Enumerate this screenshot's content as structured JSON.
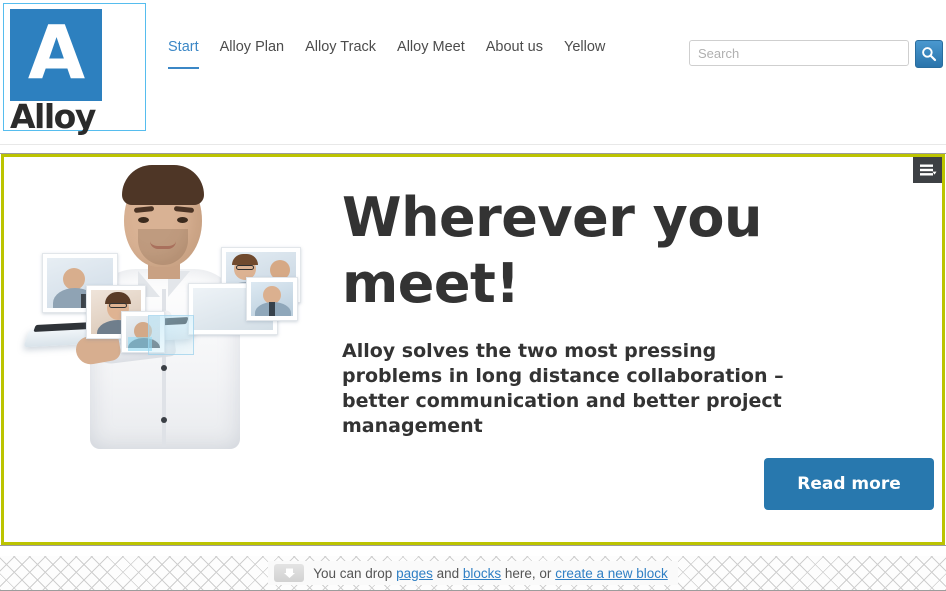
{
  "header": {
    "logo": {
      "letter": "A",
      "wordmark": "Alloy",
      "alt": "Alloy logo"
    },
    "nav": {
      "items": [
        {
          "label": "Start",
          "active": true
        },
        {
          "label": "Alloy Plan",
          "active": false
        },
        {
          "label": "Alloy Track",
          "active": false
        },
        {
          "label": "Alloy Meet",
          "active": false
        },
        {
          "label": "About us",
          "active": false
        },
        {
          "label": "Yellow",
          "active": false
        }
      ]
    },
    "search": {
      "placeholder": "Search",
      "value": "",
      "button_icon": "search-icon",
      "button_label": "Search"
    }
  },
  "block": {
    "menu_icon": "block-menu-icon",
    "border_color": "#bcc400",
    "hero": {
      "image_alt": "Man in white shirt holding a tablet with floating video call photos",
      "heading": "Wherever you meet!",
      "subheading": "Alloy solves the two most pressing problems in long distance collaboration – better communication and better project management",
      "cta_label": "Read more",
      "cta_color": "#2878ae"
    }
  },
  "drop_zone": {
    "arrow_icon": "drop-arrow-icon",
    "text_before": "You can drop ",
    "link_pages": "pages",
    "text_middle": " and ",
    "link_blocks": "blocks",
    "text_after": " here, or ",
    "link_create": "create a new block"
  },
  "colors": {
    "brand_blue": "#2d80bf",
    "nav_active": "#3b87c6",
    "block_border": "#bcc400",
    "menu_dark": "#3d4044"
  }
}
